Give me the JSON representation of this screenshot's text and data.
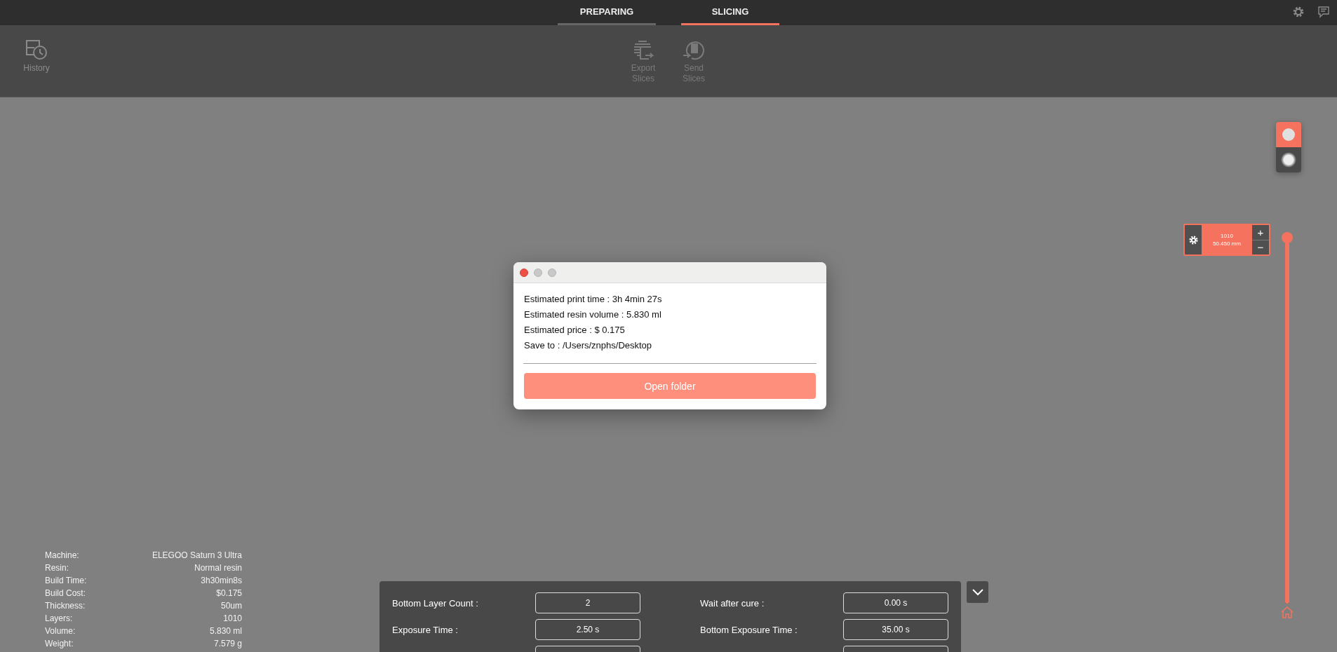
{
  "tabs": [
    {
      "label": "PREPARING",
      "selected": false
    },
    {
      "label": "SLICING",
      "selected": true
    }
  ],
  "toolbar": {
    "left": [
      {
        "kind": "history",
        "label": "History"
      }
    ],
    "center": [
      {
        "kind": "export",
        "label": "Export Slices"
      },
      {
        "kind": "send",
        "label": "Send Slices"
      }
    ]
  },
  "dialog": {
    "lines": [
      "Estimated print time : 3h 4min 27s",
      "Estimated resin volume : 5.830 ml",
      "Estimated price : $ 0.175",
      "Save to : /Users/znphs/Desktop"
    ],
    "button": "Open folder"
  },
  "view_toggle": [
    {
      "kind": "solid",
      "selected": true
    },
    {
      "kind": "blurred",
      "selected": false
    }
  ],
  "layer_control": {
    "layer": "1010",
    "height": "50.450 mm",
    "plus": "+",
    "minus": "−"
  },
  "layer_slider": {
    "level": 1
  },
  "print_info": [
    {
      "label": "Machine:",
      "value": "ELEGOO Saturn 3 Ultra"
    },
    {
      "label": "Resin:",
      "value": "Normal resin"
    },
    {
      "label": "Build Time:",
      "value": "3h30min8s"
    },
    {
      "label": "Build Cost:",
      "value": "$0.175"
    },
    {
      "label": "Thickness:",
      "value": "50um"
    },
    {
      "label": "Layers:",
      "value": "1010"
    },
    {
      "label": "Volume:",
      "value": "5.830 ml"
    },
    {
      "label": "Weight:",
      "value": "7.579 g"
    }
  ],
  "parameters": [
    {
      "label": "Bottom Layer Count :",
      "value": "2"
    },
    {
      "label": "Wait after cure :",
      "value": "0.00 s"
    },
    {
      "label": "Exposure Time :",
      "value": "2.50 s"
    },
    {
      "label": "Bottom Exposure Time :",
      "value": "35.00 s"
    }
  ]
}
